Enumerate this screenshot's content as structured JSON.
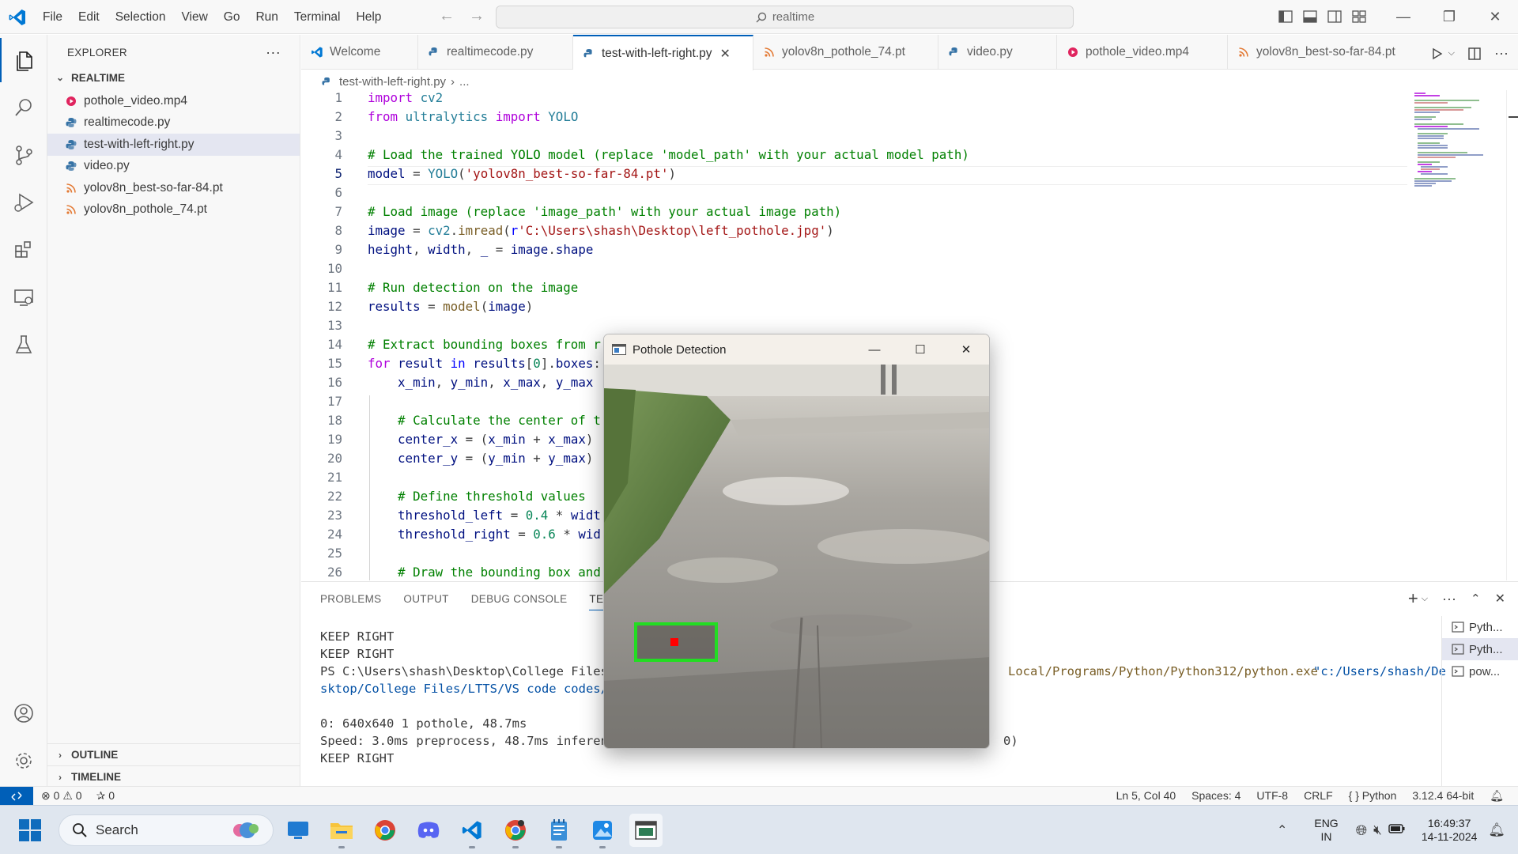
{
  "titlebar": {
    "menu": [
      "File",
      "Edit",
      "Selection",
      "View",
      "Go",
      "Run",
      "Terminal",
      "Help"
    ],
    "search_text": "realtime"
  },
  "sidebar": {
    "header": "EXPLORER",
    "folder": "REALTIME",
    "files": [
      {
        "name": "pothole_video.mp4",
        "type": "video"
      },
      {
        "name": "realtimecode.py",
        "type": "python"
      },
      {
        "name": "test-with-left-right.py",
        "type": "python"
      },
      {
        "name": "video.py",
        "type": "python"
      },
      {
        "name": "yolov8n_best-so-far-84.pt",
        "type": "pt"
      },
      {
        "name": "yolov8n_pothole_74.pt",
        "type": "pt"
      }
    ],
    "outline": "OUTLINE",
    "timeline": "TIMELINE"
  },
  "tabs": [
    {
      "label": "Welcome",
      "type": "vscode"
    },
    {
      "label": "realtimecode.py",
      "type": "python"
    },
    {
      "label": "test-with-left-right.py",
      "type": "python"
    },
    {
      "label": "yolov8n_pothole_74.pt",
      "type": "pt"
    },
    {
      "label": "video.py",
      "type": "python"
    },
    {
      "label": "pothole_video.mp4",
      "type": "video"
    },
    {
      "label": "yolov8n_best-so-far-84.pt",
      "type": "pt"
    }
  ],
  "breadcrumb": {
    "file": "test-with-left-right.py",
    "rest": "..."
  },
  "editor": {
    "line_numbers": [
      "1",
      "2",
      "3",
      "4",
      "5",
      "6",
      "7",
      "8",
      "9",
      "10",
      "11",
      "12",
      "13",
      "14",
      "15",
      "16",
      "17",
      "18",
      "19",
      "20",
      "21",
      "22",
      "23",
      "24",
      "25",
      "26"
    ],
    "current_line": 5
  },
  "panel": {
    "tabs": [
      "PROBLEMS",
      "OUTPUT",
      "DEBUG CONSOLE",
      "TERMI"
    ],
    "terminal_lines": [
      "KEEP RIGHT",
      "KEEP RIGHT",
      "PS C:\\Users\\shash\\Desktop\\College Files\\",
      "sktop/College Files/LTTS/VS code codes/r",
      "",
      "0: 640x640 1 pothole, 48.7ms",
      "Speed: 3.0ms preprocess, 48.7ms inferenc",
      "KEEP RIGHT"
    ],
    "terminal_right_path": "Local/Programs/Python/Python312/python.exe",
    "terminal_right_str": "\"c:/Users/shash/De",
    "terminal_right_tail": "0)",
    "term_list": [
      "Pyth...",
      "Pyth...",
      "pow..."
    ]
  },
  "statusbar": {
    "errors": "0",
    "warnings": "0",
    "ports": "0",
    "position": "Ln 5, Col 40",
    "spaces": "Spaces: 4",
    "encoding": "UTF-8",
    "eol": "CRLF",
    "language": "Python",
    "interpreter": "3.12.4 64-bit"
  },
  "taskbar": {
    "search": "Search",
    "lang1": "ENG",
    "lang2": "IN",
    "time": "16:49:37",
    "date": "14-11-2024"
  },
  "popup": {
    "title": "Pothole Detection"
  },
  "colors": {
    "accent": "#005fb8",
    "box": "#22dd22",
    "center": "#ff0000"
  }
}
